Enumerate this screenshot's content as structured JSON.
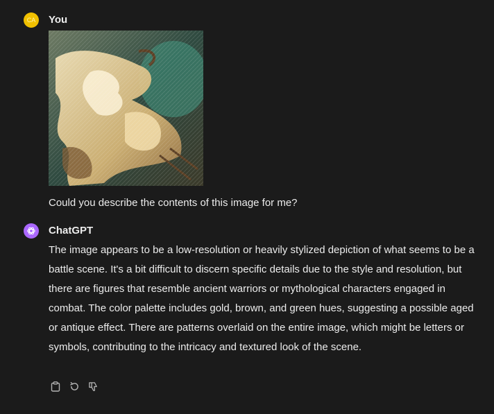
{
  "user": {
    "avatar_initials": "CA",
    "avatar_color": "#f0c000",
    "name": "You",
    "message": "Could you describe the contents of this image for me?"
  },
  "assistant": {
    "name": "ChatGPT",
    "avatar_color": "#ab68ff",
    "message": "The image appears to be a low-resolution or heavily stylized depiction of what seems to be a battle scene. It's a bit difficult to discern specific details due to the style and resolution, but there are figures that resemble ancient warriors or mythological characters engaged in combat. The color palette includes gold, brown, and green hues, suggesting a possible aged or antique effect. There are patterns overlaid on the entire image, which might be letters or symbols, contributing to the intricacy and textured look of the scene."
  },
  "message_actions": [
    {
      "icon": "clipboard-icon"
    },
    {
      "icon": "regenerate-icon"
    },
    {
      "icon": "thumbs-down-icon"
    }
  ]
}
